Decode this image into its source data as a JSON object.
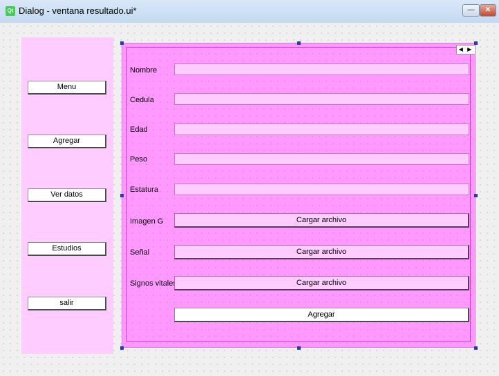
{
  "window": {
    "app_icon": "qt-logo",
    "app_icon_text": "Qt",
    "title": "Dialog - ventana resultado.ui*",
    "minimize_symbol": "—",
    "close_symbol": "✕"
  },
  "sidebar": {
    "background": "#ffccff",
    "buttons": [
      {
        "label": "Menu"
      },
      {
        "label": "Agregar"
      },
      {
        "label": "Ver datos"
      },
      {
        "label": "Estudios"
      },
      {
        "label": "salir"
      }
    ]
  },
  "form": {
    "background": "#ff99ff",
    "nav_arrows": "◀ ▶",
    "fields": [
      {
        "label": "Nombre",
        "value": ""
      },
      {
        "label": "Cedula",
        "value": ""
      },
      {
        "label": "Edad",
        "value": ""
      },
      {
        "label": "Peso",
        "value": ""
      },
      {
        "label": "Estatura",
        "value": ""
      }
    ],
    "uploads": [
      {
        "label": "Imagen G",
        "button": "Cargar archivo"
      },
      {
        "label": "Señal",
        "button": "Cargar archivo"
      },
      {
        "label": "Signos vitales",
        "button": "Cargar archivo"
      }
    ],
    "submit_label": "Agregar"
  }
}
